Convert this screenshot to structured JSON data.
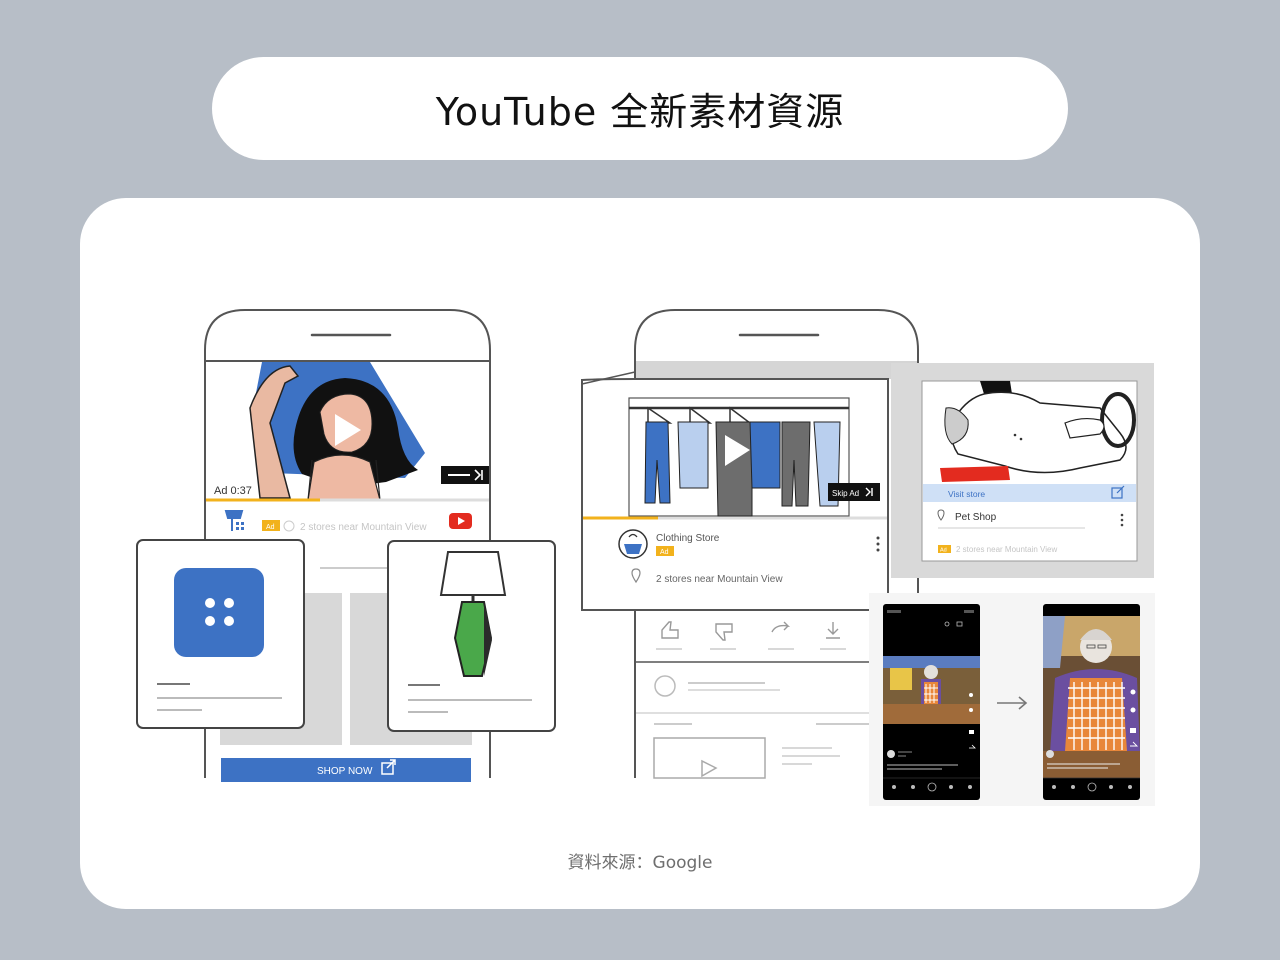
{
  "header": {
    "title": "YouTube 全新素材資源"
  },
  "left_phone": {
    "ad_timer": "Ad 0:37",
    "ad_badge": "Ad",
    "stores_text": "2 stores near Mountain View",
    "shop_now_label": "SHOP NOW"
  },
  "middle_phone": {
    "skip_ad_label": "Skip Ad",
    "store_name": "Clothing Store",
    "ad_badge": "Ad",
    "stores_text": "2 stores near Mountain View"
  },
  "pet_card": {
    "visit_store_label": "Visit store",
    "store_name": "Pet Shop",
    "ad_badge": "Ad",
    "stores_text": "2 stores near Mountain View"
  },
  "colors": {
    "brand_blue": "#3d72c4",
    "ad_yellow": "#f2b21c",
    "youtube_red": "#e32b1f",
    "lamp_green": "#4aa84a",
    "visit_bar": "#cfe0f6"
  },
  "footer": {
    "source": "資料來源：Google"
  }
}
